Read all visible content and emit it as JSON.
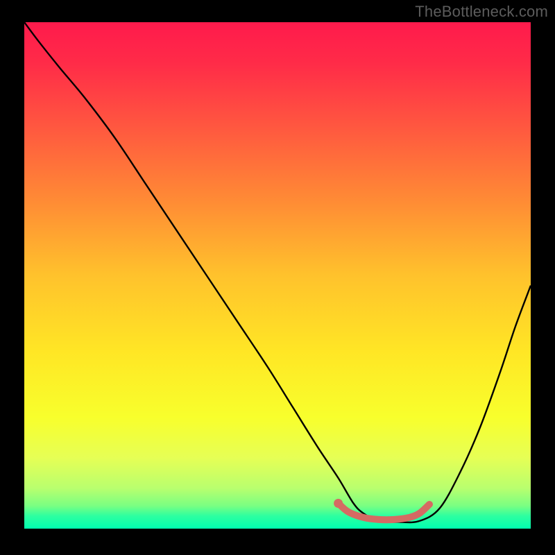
{
  "watermark": "TheBottleneck.com",
  "colors": {
    "frame_bg": "#000000",
    "watermark": "#5c5c5c",
    "curve": "#000000",
    "valley_marker": "#d56a63"
  },
  "chart_data": {
    "type": "line",
    "title": "",
    "xlabel": "",
    "ylabel": "",
    "xlim": [
      0,
      100
    ],
    "ylim": [
      0,
      100
    ],
    "gradient_stops": [
      {
        "offset": 0.0,
        "color": "#ff1a4c"
      },
      {
        "offset": 0.08,
        "color": "#ff2b48"
      },
      {
        "offset": 0.2,
        "color": "#ff5540"
      },
      {
        "offset": 0.35,
        "color": "#ff8a35"
      },
      {
        "offset": 0.5,
        "color": "#ffc22c"
      },
      {
        "offset": 0.65,
        "color": "#ffe625"
      },
      {
        "offset": 0.78,
        "color": "#f8ff2c"
      },
      {
        "offset": 0.86,
        "color": "#e6ff55"
      },
      {
        "offset": 0.92,
        "color": "#b9ff6e"
      },
      {
        "offset": 0.955,
        "color": "#7aff82"
      },
      {
        "offset": 0.975,
        "color": "#2dffa0"
      },
      {
        "offset": 1.0,
        "color": "#00ffb0"
      }
    ],
    "series": [
      {
        "name": "bottleneck-curve",
        "x": [
          0,
          3,
          7,
          12,
          18,
          24,
          30,
          36,
          42,
          48,
          53,
          58,
          62,
          65,
          67,
          70,
          74,
          78,
          82,
          86,
          90,
          94,
          97,
          100
        ],
        "values": [
          100,
          96,
          91,
          85,
          77,
          68,
          59,
          50,
          41,
          32,
          24,
          16,
          10,
          5,
          3,
          1.5,
          1.3,
          1.5,
          4,
          11,
          20,
          31,
          40,
          48
        ]
      }
    ],
    "valley_marker": {
      "x": [
        62,
        64,
        67,
        70,
        73,
        76,
        78,
        80
      ],
      "values": [
        5,
        3.3,
        2.2,
        1.8,
        1.8,
        2.2,
        3.0,
        4.8
      ]
    }
  }
}
